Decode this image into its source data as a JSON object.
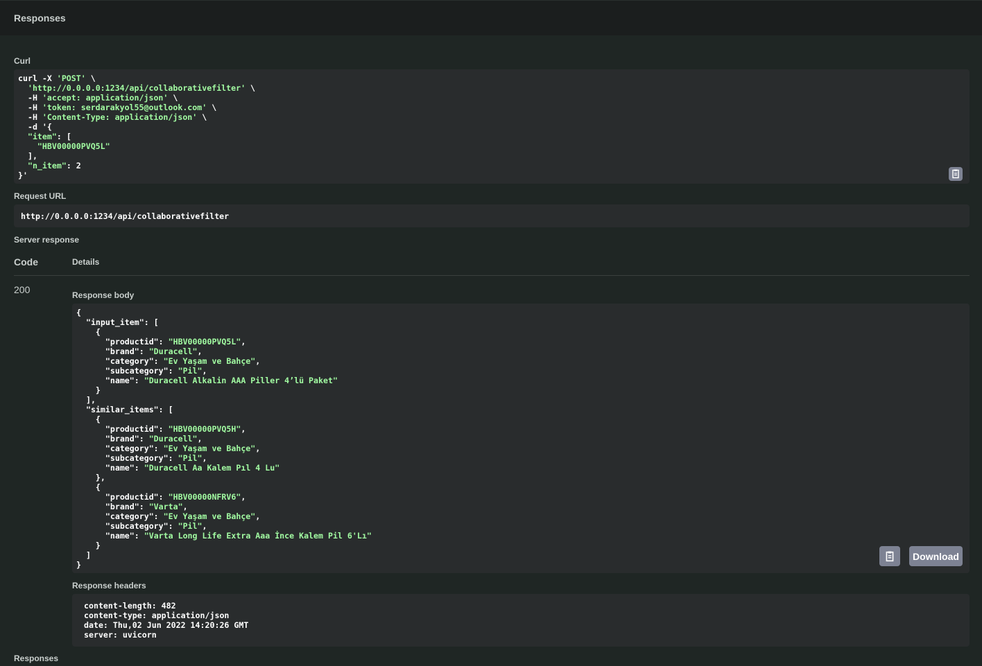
{
  "header": {
    "title": "Responses"
  },
  "curl": {
    "label": "Curl",
    "lines": [
      "curl -X 'POST' \\",
      "  'http://0.0.0.0:1234/api/collaborativefilter' \\",
      "  -H 'accept: application/json' \\",
      "  -H 'token: serdarakyol55@outlook.com' \\",
      "  -H 'Content-Type: application/json' \\",
      "  -d '{",
      "  \"item\": [",
      "    \"HBV00000PVQ5L\"",
      "  ],",
      "  \"n_item\": 2",
      "}'"
    ]
  },
  "request_url": {
    "label": "Request URL",
    "value": "http://0.0.0.0:1234/api/collaborativefilter"
  },
  "server_response": {
    "label": "Server response",
    "code_header": "Code",
    "details_header": "Details",
    "status_code": "200",
    "body_label": "Response body",
    "body": {
      "input_item": [
        {
          "productid": "HBV00000PVQ5L",
          "brand": "Duracell",
          "category": "Ev Yaşam ve Bahçe",
          "subcategory": "Pil",
          "name": "Duracell Alkalin AAA Piller 4’lü Paket"
        }
      ],
      "similar_items": [
        {
          "productid": "HBV00000PVQ5H",
          "brand": "Duracell",
          "category": "Ev Yaşam ve Bahçe",
          "subcategory": "Pil",
          "name": "Duracell Aa Kalem Pıl 4 Lu"
        },
        {
          "productid": "HBV00000NFRV6",
          "brand": "Varta",
          "category": "Ev Yaşam ve Bahçe",
          "subcategory": "Pil",
          "name": "Varta Long Life Extra Aaa İnce Kalem Pil 6'Lı"
        }
      ]
    },
    "download_label": "Download",
    "headers_label": "Response headers",
    "headers": [
      "content-length: 482",
      "content-type: application/json",
      "date: Thu,02 Jun 2022 14:20:26 GMT",
      "server: uvicorn"
    ]
  },
  "footer": {
    "label": "Responses"
  },
  "icons": {
    "copy": "clipboard-copy-icon"
  },
  "colors": {
    "string": "#a2fca2",
    "button": "#7d8293",
    "codebox": "#292c2d"
  }
}
